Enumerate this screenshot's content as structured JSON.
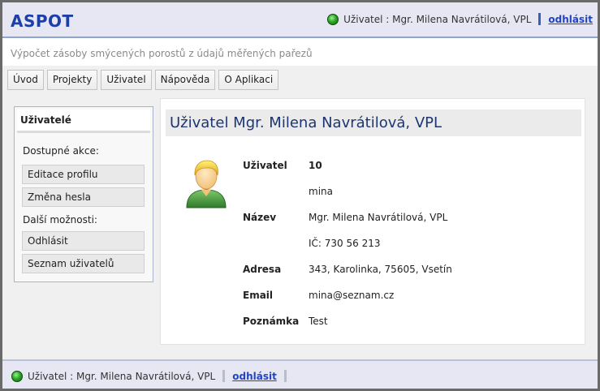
{
  "app": {
    "logo": "ASPOT",
    "subtitle": "Výpočet zásoby smýcených porostů z údajů měřených pařezů"
  },
  "header": {
    "user_text": "Uživatel : Mgr. Milena Navrátilová, VPL",
    "logout_label": "odhlásit",
    "status_color": "#2ea82a"
  },
  "nav": {
    "items": [
      {
        "label": "Úvod"
      },
      {
        "label": "Projekty"
      },
      {
        "label": "Uživatel"
      },
      {
        "label": "Nápověda"
      },
      {
        "label": "O Aplikaci"
      }
    ]
  },
  "sidebar": {
    "title": "Uživatelé",
    "available_actions_label": "Dostupné akce:",
    "edit_profile_label": "Editace profilu",
    "change_password_label": "Změna hesla",
    "more_options_label": "Další možnosti:",
    "logout_label": "Odhlásit",
    "user_list_label": "Seznam uživatelů"
  },
  "main": {
    "title": "Uživatel Mgr. Milena Navrátilová, VPL",
    "avatar_icon": "user-avatar-icon",
    "fields": {
      "user_label": "Uživatel",
      "user_id": "10",
      "username": "mina",
      "name_label": "Název",
      "name_value": "Mgr. Milena Navrátilová, VPL",
      "ic_value": "IČ: 730 56 213",
      "address_label": "Adresa",
      "address_value": "343, Karolinka, 75605, Vsetín",
      "email_label": "Email",
      "email_value": "mina@seznam.cz",
      "note_label": "Poznámka",
      "note_value": "Test"
    }
  },
  "footer": {
    "user_text": "Uživatel : Mgr. Milena Navrátilová, VPL",
    "logout_label": "odhlásit"
  },
  "colors": {
    "accent": "#1d3fa8",
    "header_bg": "#e7e7f3",
    "title_text": "#1c3673"
  }
}
